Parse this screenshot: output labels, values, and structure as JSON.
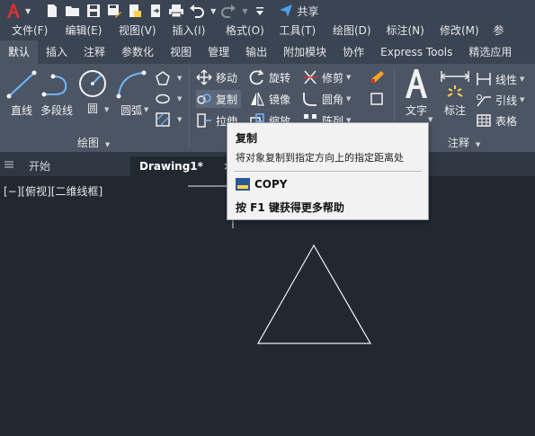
{
  "quick_access": {
    "share_label": "共享",
    "icons": [
      "autocad-logo-icon",
      "new-file-icon",
      "open-folder-icon",
      "save-icon",
      "save-as-icon",
      "open-sheet-icon",
      "export-icon",
      "print-icon",
      "undo-icon",
      "redo-icon",
      "customize-dropdown-icon",
      "share-icon"
    ]
  },
  "menu": {
    "items": [
      "文件(F)",
      "编辑(E)",
      "视图(V)",
      "插入(I)",
      "格式(O)",
      "工具(T)",
      "绘图(D)",
      "标注(N)",
      "修改(M)",
      "参"
    ]
  },
  "ribbon_tabs": {
    "items": [
      "默认",
      "插入",
      "注释",
      "参数化",
      "视图",
      "管理",
      "输出",
      "附加模块",
      "协作",
      "Express Tools",
      "精选应用"
    ],
    "active_index": 0
  },
  "ribbon": {
    "draw": {
      "line": "直线",
      "polyline": "多段线",
      "circle": "圆",
      "arc": "圆弧",
      "panel_label": "绘图"
    },
    "modify": {
      "move": "移动",
      "rotate": "旋转",
      "trim": "修剪",
      "copy": "复制",
      "mirror": "镜像",
      "fillet": "圆角",
      "stretch": "拉伸",
      "scale": "缩放",
      "array": "阵列"
    },
    "annotation": {
      "text": "文字",
      "dimension": "标注",
      "linear": "线性",
      "leader": "引线",
      "table": "表格",
      "panel_label": "注释"
    }
  },
  "file_tabs": {
    "start": "开始",
    "drawing": "Drawing1*",
    "close_symbol": "×"
  },
  "viewport": {
    "label": "[−][俯视][二维线框]"
  },
  "tooltip": {
    "title": "复制",
    "description": "将对象复制到指定方向上的指定距离处",
    "command": "COPY",
    "help": "按 F1 键获得更多帮助"
  },
  "colors": {
    "background": "#212830",
    "ribbon": "#4c5564",
    "accent": "#e0312f",
    "share": "#4aa3f0"
  }
}
